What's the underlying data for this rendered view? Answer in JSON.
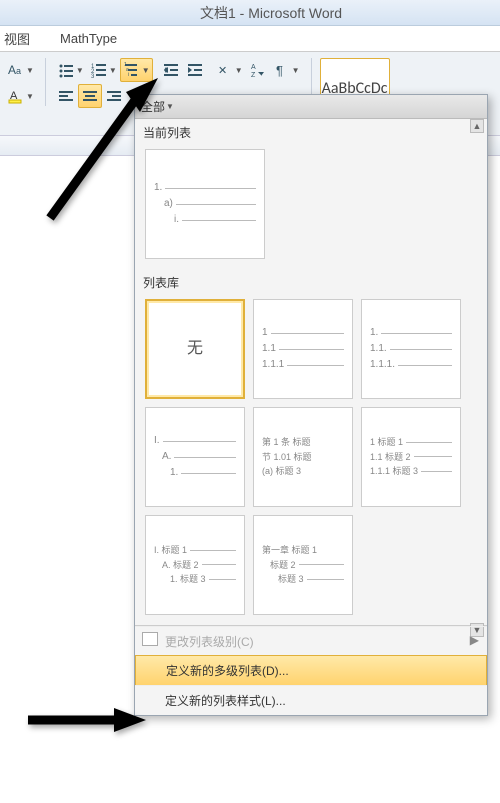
{
  "title": "文档1 - Microsoft Word",
  "tabs": {
    "view": "视图",
    "mathtype": "MathType"
  },
  "ribbon": {
    "styles_preview": "AaBbCcDc"
  },
  "dropdown": {
    "header": "全部",
    "section_current": "当前列表",
    "section_library": "列表库",
    "none_label": "无",
    "thumbs": {
      "current": [
        {
          "l1": "1.",
          "l2": "a)",
          "l3": "i."
        }
      ],
      "library": [
        {
          "none": true
        },
        {
          "l1": "1",
          "l2": "1.1",
          "l3": "1.1.1"
        },
        {
          "l1": "1.",
          "l2": "1.1.",
          "l3": "1.1.1."
        },
        {
          "l1": "I.",
          "l2": "A.",
          "l3": "1."
        },
        {
          "l1": "第 1 条 标题",
          "l2": "节 1.01 标题",
          "l3": "(a) 标题 3"
        },
        {
          "l1": "1 标题 1",
          "l2": "1.1 标题 2",
          "l3": "1.1.1 标题 3"
        },
        {
          "l1": "I. 标题 1",
          "l2": "A. 标题 2",
          "l3": "1. 标题 3"
        },
        {
          "l1": "第一章 标题 1",
          "l2": "标题 2",
          "l3": "标题 3"
        }
      ]
    },
    "footer": {
      "change_level": "更改列表级别(C)",
      "define_new": "定义新的多级列表(D)...",
      "define_style": "定义新的列表样式(L)..."
    }
  }
}
